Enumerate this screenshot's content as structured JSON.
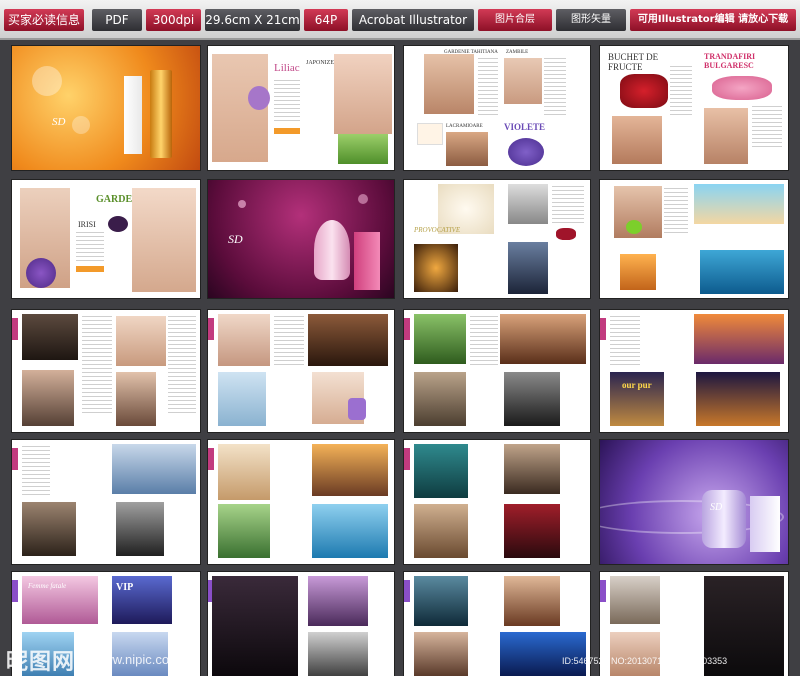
{
  "header": {
    "items": [
      {
        "label": "买家必读信息",
        "style": "red"
      },
      {
        "label": "PDF",
        "style": "dark"
      },
      {
        "label": "300dpi",
        "style": "red"
      },
      {
        "label": "29.6cm X 21cm",
        "style": "dark"
      },
      {
        "label": "64P",
        "style": "red"
      },
      {
        "label": "Acrobat  Illustrator",
        "style": "dark"
      },
      {
        "label": "图片合层",
        "style": "red"
      },
      {
        "label": "图形矢量",
        "style": "dark"
      },
      {
        "label": "可用Illustrator编辑 请放心下载",
        "style": "red"
      }
    ]
  },
  "spreads": {
    "cover": {
      "brand": "SD"
    },
    "s2": {
      "title": "Liliac",
      "subtitle": "JAPONIZE"
    },
    "s3": {
      "heading": "GARDENIE TAHITIANA",
      "heading2": "ZAMBILE",
      "heading3": "LACRAMIOARE",
      "title": "VIOLETE"
    },
    "s4": {
      "title_left": "BUCHET DE FRUCTE",
      "title_right": "TRANDAFIRI BULGARESC"
    },
    "s5": {
      "title": "GARDEN",
      "subtitle": "IRISI"
    },
    "s6": {
      "brand": "SD"
    },
    "s7": {
      "title": "PROVOCATIVE"
    },
    "s12": {
      "title": "our pur"
    },
    "s16": {
      "brand": "SD"
    },
    "s17": {
      "title": "Femme fatale",
      "title2": "VIP"
    }
  },
  "watermark": {
    "site_logo": "昵图网",
    "site_url": "www.nipic.com",
    "id_text": "ID:5467522 NO:20130713215345003353"
  }
}
